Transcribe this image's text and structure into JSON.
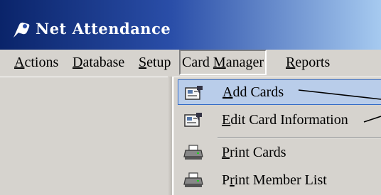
{
  "window": {
    "title": "Net Attendance"
  },
  "menubar": {
    "items": [
      {
        "pre": "",
        "key": "A",
        "post": "ctions"
      },
      {
        "pre": "",
        "key": "D",
        "post": "atabase"
      },
      {
        "pre": "",
        "key": "S",
        "post": "etup"
      },
      {
        "pre": "Card ",
        "key": "M",
        "post": "anager"
      },
      {
        "pre": "",
        "key": "R",
        "post": "eports"
      }
    ],
    "active_index": 3
  },
  "dropdown": {
    "items": [
      {
        "pre": "",
        "key": "A",
        "post": "dd Cards",
        "icon": "card-edit-icon"
      },
      {
        "pre": "",
        "key": "E",
        "post": "dit Card Information",
        "icon": "card-edit-icon"
      },
      {
        "pre": "",
        "key": "P",
        "post": "rint Cards",
        "icon": "printer-icon"
      },
      {
        "pre": "P",
        "key": "r",
        "post": "int Member List",
        "icon": "printer-icon"
      }
    ],
    "highlighted_index": 0
  },
  "colors": {
    "title_start": "#0a246a",
    "title_end": "#a6caf0",
    "menu_bg": "#d6d3ce",
    "highlight_bg": "#b9cdea",
    "highlight_border": "#316ac5"
  }
}
